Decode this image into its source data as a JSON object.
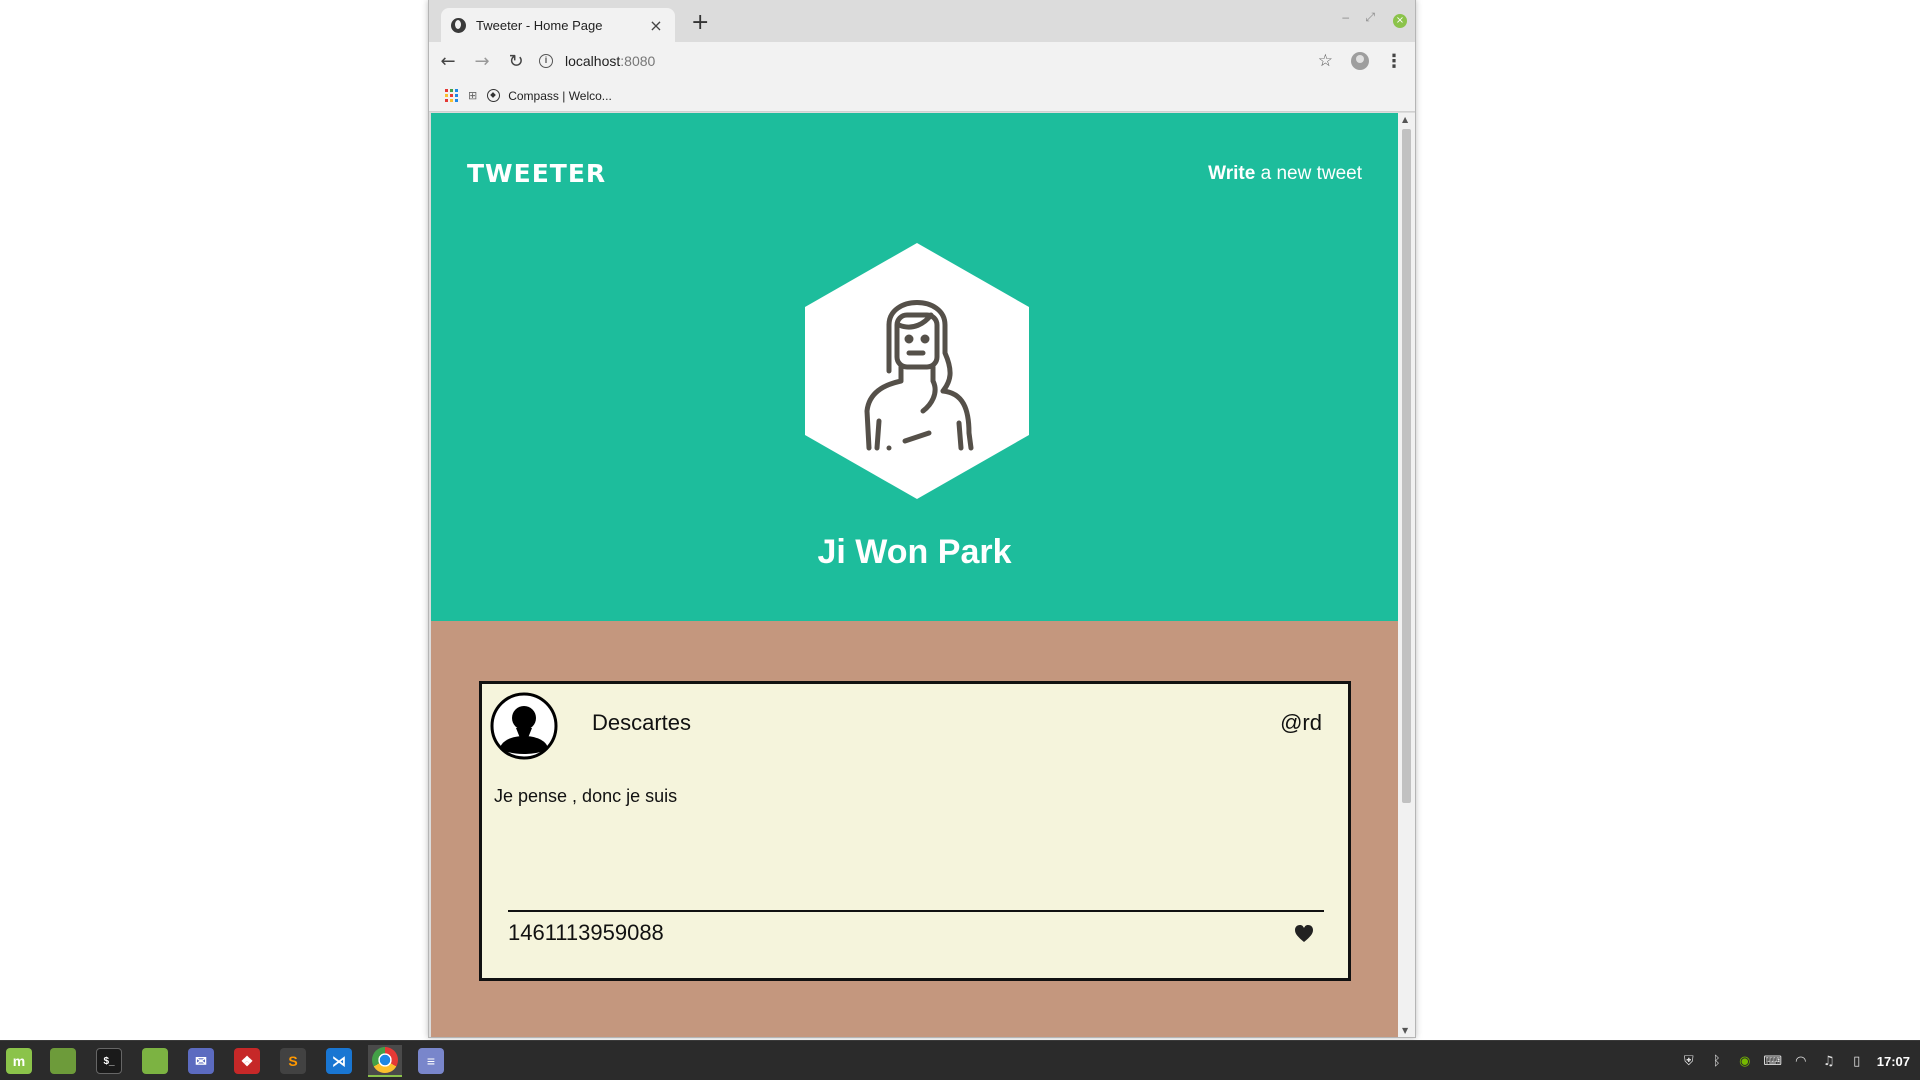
{
  "browser": {
    "tab_title": "Tweeter - Home Page",
    "tab_close": "×",
    "new_tab": "+",
    "url_host": "localhost",
    "url_port": ":8080",
    "bookmarks": [
      {
        "label": "Compass | Welco..."
      }
    ]
  },
  "page": {
    "brand": "TWEETER",
    "write_bold": "Write",
    "write_rest": " a new tweet",
    "user_name": "Ji Won Park",
    "colors": {
      "hero": "#1dbd9c",
      "body": "#c4977e",
      "tweet_bg": "#f5f4dc"
    }
  },
  "tweet": {
    "author": "Descartes",
    "handle": "@rd",
    "body": "Je pense , donc je suis",
    "timestamp": "1461113959088"
  },
  "taskbar": {
    "items": [
      {
        "name": "mint-menu-icon",
        "color": "#8bc34a",
        "glyph": "m"
      },
      {
        "name": "show-desktop-icon",
        "color": "#6d9b3a",
        "glyph": ""
      },
      {
        "name": "terminal-icon",
        "color": "#1a1a1a",
        "glyph": "$_"
      },
      {
        "name": "files-icon",
        "color": "#7cb342",
        "glyph": ""
      },
      {
        "name": "mail-icon",
        "color": "#5c6bc0",
        "glyph": "✉"
      },
      {
        "name": "git-client-icon",
        "color": "#c62828",
        "glyph": "❖"
      },
      {
        "name": "sublime-text-icon",
        "color": "#424242",
        "glyph": "S"
      },
      {
        "name": "vscode-icon",
        "color": "#1976d2",
        "glyph": "⋊"
      },
      {
        "name": "chrome-icon",
        "color": "#ffffff",
        "glyph": ""
      },
      {
        "name": "text-editor-icon",
        "color": "#7986cb",
        "glyph": "≡"
      }
    ],
    "clock": "17:07"
  }
}
